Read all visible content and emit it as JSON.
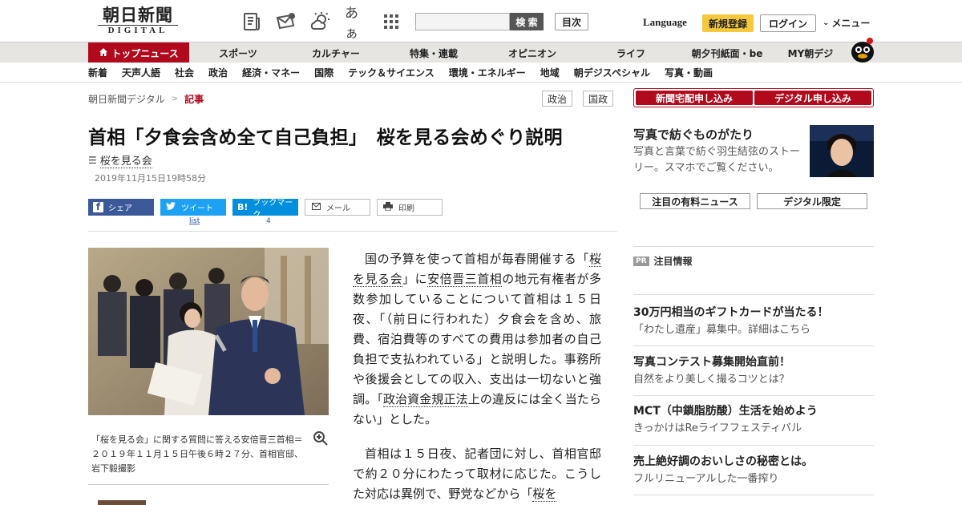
{
  "header": {
    "logo_main": "朝日新聞",
    "logo_sub": "DIGITAL",
    "icons": [
      "paper-icon",
      "mail-icon",
      "weather-icon",
      "font-size-icon",
      "grid-icon"
    ],
    "font_size_label": "あぁ",
    "search_placeholder": "",
    "search_button": "検 索",
    "toc_button": "目次",
    "language": "Language",
    "register_button": "新規登録",
    "login_button": "ログイン",
    "menu_button": "メニュー"
  },
  "nav_primary": [
    {
      "label": "トップニュース",
      "active": true
    },
    {
      "label": "スポーツ"
    },
    {
      "label": "カルチャー"
    },
    {
      "label": "特集・連載"
    },
    {
      "label": "オピニオン"
    },
    {
      "label": "ライフ"
    },
    {
      "label": "朝夕刊紙面・be"
    },
    {
      "label": "MY朝デジ"
    }
  ],
  "nav_secondary": [
    "新着",
    "天声人語",
    "社会",
    "政治",
    "経済・マネー",
    "国際",
    "テック＆サイエンス",
    "環境・エネルギー",
    "地域",
    "朝デジスペシャル",
    "写真・動画"
  ],
  "breadcrumb": {
    "home": "朝日新聞デジタル",
    "separator": ">",
    "current": "記事"
  },
  "tags": [
    "政治",
    "国政"
  ],
  "article": {
    "headline": "首相「夕食会含め全て自己負担」　桜を見る会めぐり説明",
    "topic": "桜を見る会",
    "date": "2019年11月15日19時58分",
    "share": {
      "facebook": "シェア",
      "twitter": "ツイート",
      "twitter_count": "list",
      "hatena": "ブックマーク",
      "hatena_icon": "B!",
      "hatena_count": "4",
      "mail": "メール",
      "print": "印刷"
    },
    "caption": "「桜を見る会」に関する質問に答える安倍晋三首相＝２０１９年１１月１５日午後６時２７分、首相官邸、岩下毅撮影",
    "p1_a": "国の予算を使って首相が毎春開催する「",
    "p1_link1": "桜を見る会",
    "p1_b": "」に",
    "p1_link2": "安倍晋三首相",
    "p1_c": "の地元有権者が多数参加していることについて首相は１５日夜、「（前日に行われた）夕食会を含め、旅費、宿泊費等のすべての費用は参加者の自己負担で支払われている」と説明した。事務所や後援会としての収入、支出は一切ないと強調。「",
    "p1_link3": "政治資金規正法",
    "p1_d": "上の違反には全く当たらない」とした。",
    "p2_a": "首相は１５日夜、記者団に対し、首相官邸で約２０分にわたって取材に応じた。こうした対応は異例で、野党などから「",
    "p2_link1": "桜を"
  },
  "sidebar": {
    "cta_home_delivery": "新聞宅配申し込み",
    "cta_digital": "デジタル申し込み",
    "photo_story_title": "写真で紡ぐものがたり",
    "photo_story_desc": "写真と言葉で紡ぐ羽生結弦のストーリー。スマホでご覧ください。",
    "tab_paid_news": "注目の有料ニュース",
    "tab_digital_only": "デジタル限定",
    "pr_badge": "PR",
    "pr_heading": "注目情報",
    "pr_items": [
      {
        "title": "30万円相当のギフトカードが当たる！",
        "sub": "「わたし遺産」募集中。詳細はこちら"
      },
      {
        "title": "写真コンテスト募集開始直前！",
        "sub": "自然をより美しく撮るコツとは？"
      },
      {
        "title": "MCT（中鎖脂肪酸）生活を始めよう",
        "sub": "きっかけはReライフフェスティバル"
      },
      {
        "title": "売上絶好調のおいしさの秘密とは。",
        "sub": "フルリニューアルした一番搾り"
      }
    ]
  },
  "colors": {
    "brand_red": "#b10a1d",
    "nav_bg": "#e6e5e1",
    "register_yellow": "#f6c83b",
    "facebook": "#3b5998",
    "twitter": "#1da1f2",
    "hatena": "#008fde"
  }
}
